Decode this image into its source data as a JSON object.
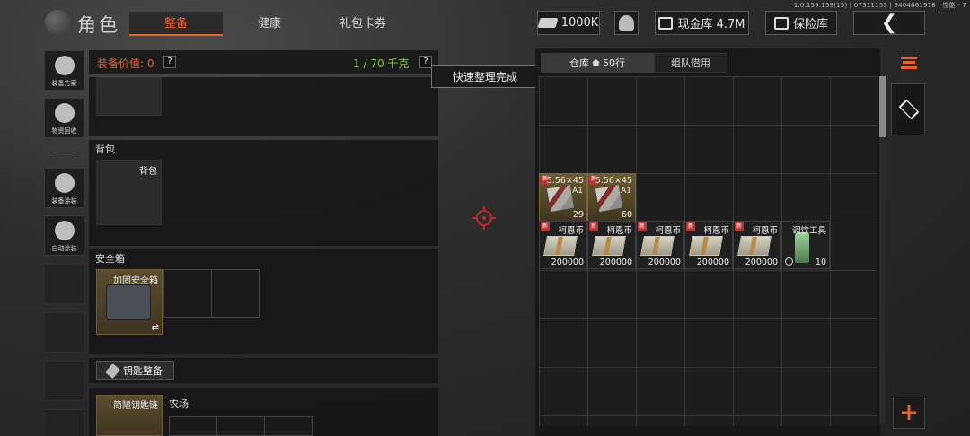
{
  "version": "1.0.159.159(15) | 07311153 | 9404661978 | 性能 - 7",
  "header": {
    "title": "角色",
    "tabs": [
      {
        "label": "整备",
        "active": true
      },
      {
        "label": "健康",
        "active": false
      },
      {
        "label": "礼包卡券",
        "active": false
      }
    ],
    "cash": "1000K",
    "cash_storage": "现金库 4.7M",
    "insurance": "保险库"
  },
  "sidebar": {
    "items": [
      {
        "label": "装备方案",
        "icon": "loadout-icon"
      },
      {
        "label": "物资回收",
        "icon": "recycle-icon"
      },
      {
        "label": "装备涂装",
        "icon": "paint-icon"
      },
      {
        "label": "自动涂装",
        "icon": "auto-paint-icon"
      }
    ]
  },
  "equipment": {
    "value_label": "装备价值: 0",
    "weight": "1 / 70 千克",
    "help": "?",
    "backpack_section": "背包",
    "backpack_slot": "背包",
    "safe_section": "安全箱",
    "safe_item": "加固安全箱",
    "safe_swap": "⇄",
    "key_button": "钥匙整备",
    "key_item": "简陋钥匙链",
    "farm_label": "农场"
  },
  "tooltip": "快速整理完成",
  "warehouse": {
    "tabs": [
      {
        "label": "仓库",
        "rows": "50行",
        "active": true
      },
      {
        "label": "组队借用",
        "active": false
      }
    ],
    "new_badge": "新",
    "items": [
      {
        "type": "ammo",
        "name": "5.56×45",
        "sub": "A1",
        "count": "29"
      },
      {
        "type": "ammo",
        "name": "5.56×45",
        "sub": "A1",
        "count": "60"
      },
      {
        "type": "cash",
        "name": "柯恩币",
        "count": "200000"
      },
      {
        "type": "cash",
        "name": "柯恩币",
        "count": "200000"
      },
      {
        "type": "cash",
        "name": "柯恩币",
        "count": "200000"
      },
      {
        "type": "cash",
        "name": "柯恩币",
        "count": "200000"
      },
      {
        "type": "cash",
        "name": "柯恩币",
        "count": "200000"
      },
      {
        "type": "tool",
        "name": "调饮工具",
        "count": "10"
      }
    ]
  },
  "colors": {
    "accent": "#e8612c",
    "weight_green": "#7fc843",
    "crosshair": "#c0282b",
    "ammo_bg": "#6a5a32"
  }
}
